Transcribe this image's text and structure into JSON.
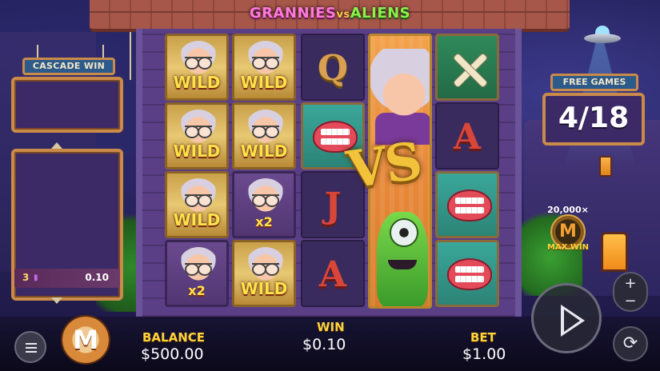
{
  "game": {
    "title_part1": "GRANNIES",
    "title_vs": "vs",
    "title_part2": "ALIENS",
    "vs_logo": "VS"
  },
  "cascade_win": {
    "label": "CASCADE WIN",
    "value": ""
  },
  "win_history": [
    {
      "count": "3",
      "amount": "0.10"
    }
  ],
  "free_games": {
    "label": "FREE GAMES",
    "value": "4/18"
  },
  "max_win": {
    "multiplier": "20,000×",
    "badge": "M",
    "label": "MAX WIN"
  },
  "reels": [
    [
      "WILD",
      "WILD",
      "WILD",
      "WILD"
    ],
    [
      "WILD",
      "WILD",
      "x2",
      "WILD"
    ],
    [
      "Q",
      "teeth",
      "J",
      "A"
    ],
    [
      "granny-vs-alien"
    ],
    [
      "bone-cross",
      "A",
      "teeth",
      "teeth"
    ]
  ],
  "multipliers": {
    "col1_row4": "x2",
    "col2_row3": "x2"
  },
  "balance": {
    "label": "BALANCE",
    "value": "$500.00"
  },
  "win": {
    "label": "WIN",
    "value": "$0.10"
  },
  "bet": {
    "label": "BET",
    "value": "$1.00"
  },
  "logo": {
    "letter": "M"
  },
  "controls": {
    "plus": "+",
    "minus": "−",
    "autoplay": "⟳"
  },
  "icons": {
    "menu": "menu-icon",
    "play": "play-icon",
    "autoplay": "autoplay-icon",
    "ufo": "ufo-icon"
  },
  "colors": {
    "accent_gold": "#ffd23a",
    "wild_text": "#ffe14a",
    "panel_bg": "#3c2a66",
    "frame_wood": "#c98a4a",
    "sign_blue": "#2c5a8a"
  }
}
